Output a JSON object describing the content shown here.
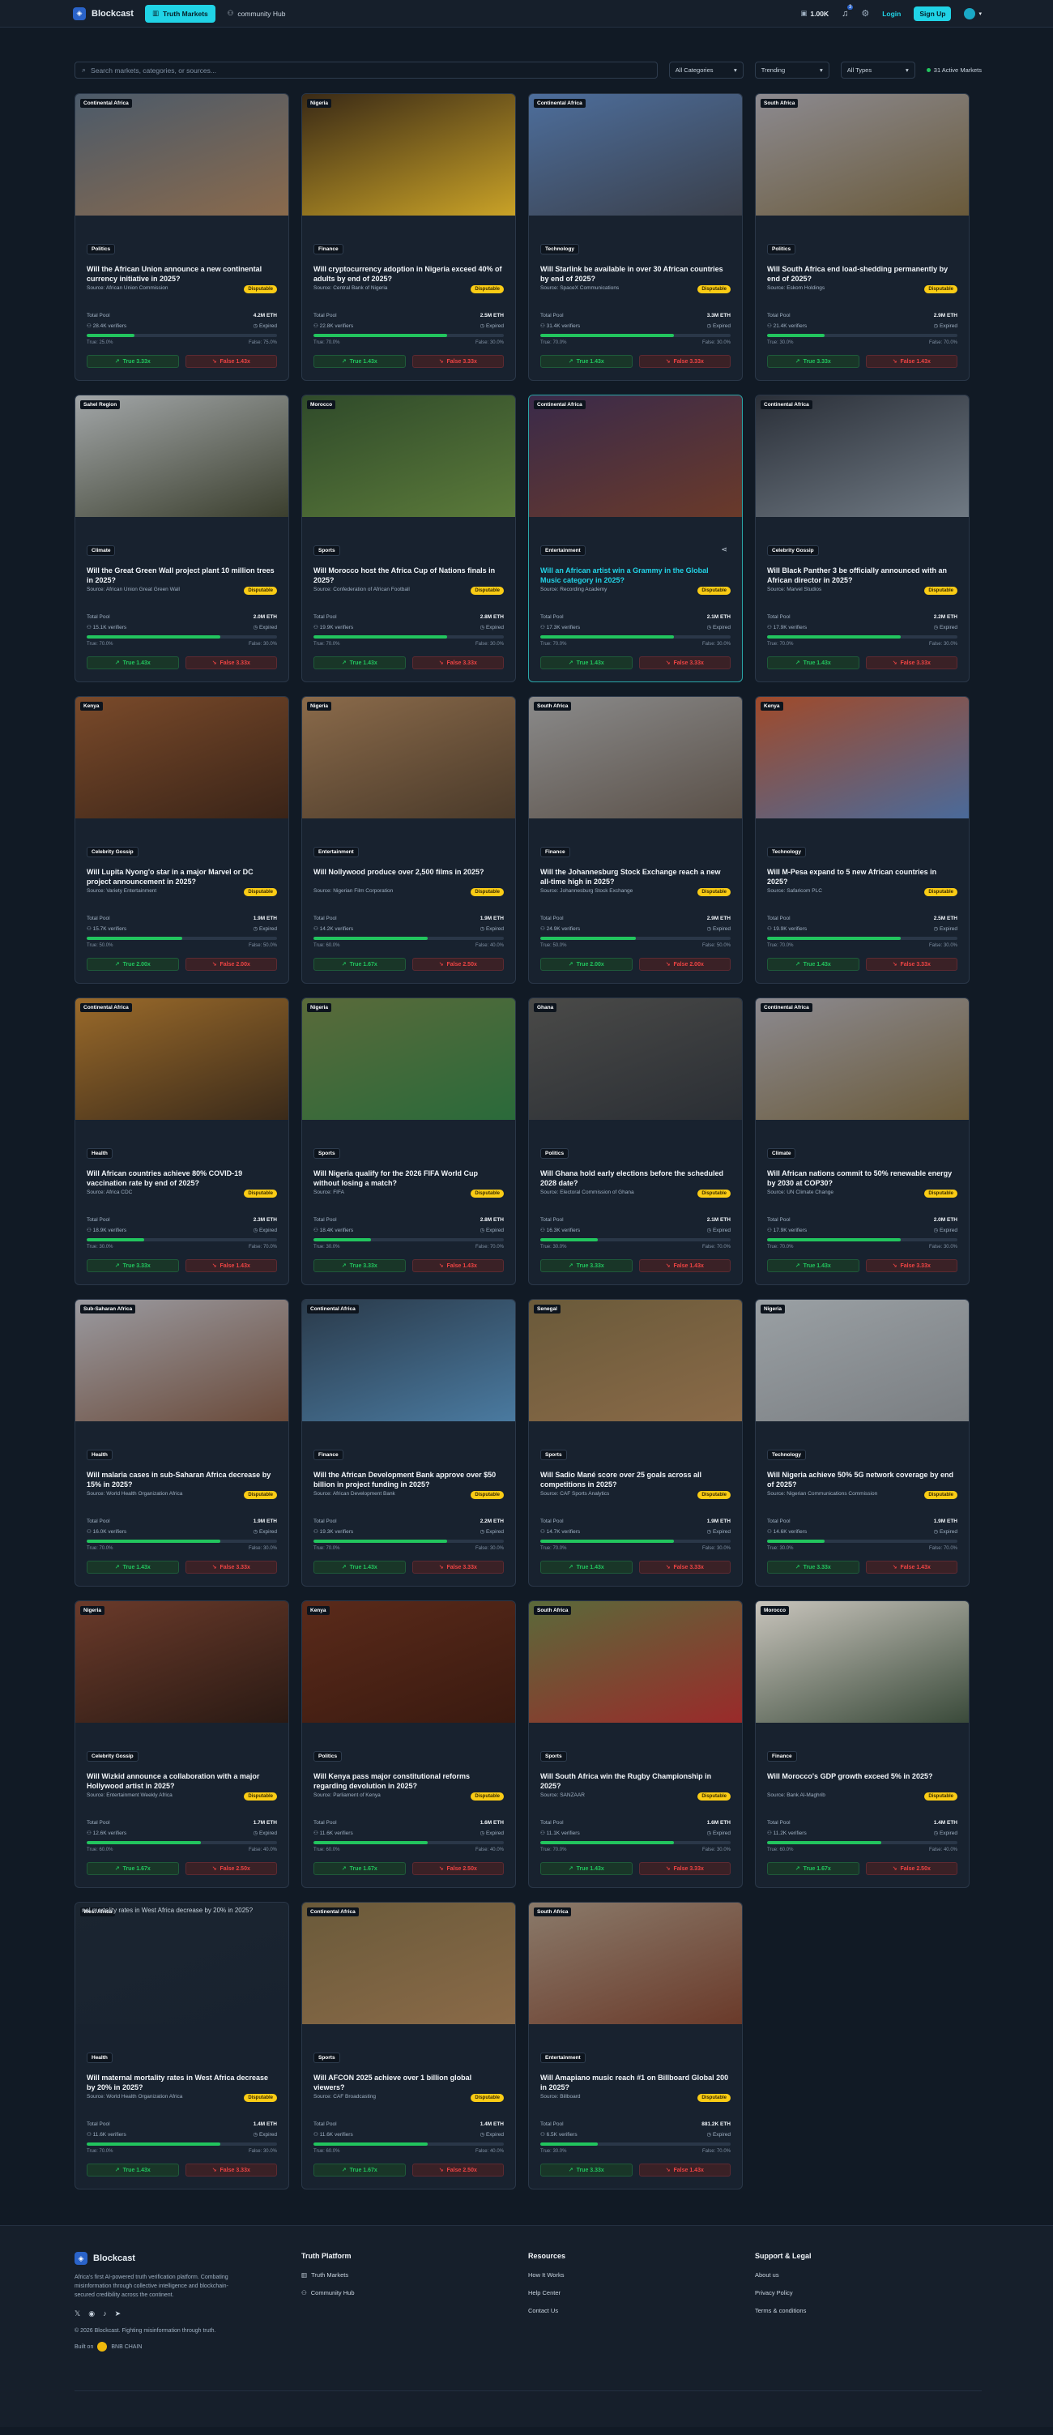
{
  "nav": {
    "brand": "Blockcast",
    "tabs": [
      {
        "label": "Truth Markets",
        "icon": "chart-icon"
      },
      {
        "label": "community Hub",
        "icon": "users-icon"
      }
    ],
    "balance": "1.00K",
    "notifications": "3",
    "login": "Login",
    "signup": "Sign Up"
  },
  "filters": {
    "search_placeholder": "Search markets, categories, or sources...",
    "categories": "All Categories",
    "sort": "Trending",
    "types": "All Types",
    "active_count": "31 Active Markets"
  },
  "common": {
    "total_pool_label": "Total Pool",
    "status": "Expired",
    "disputable": "Disputable"
  },
  "markets": [
    {
      "region": "Continental Africa",
      "category": "Politics",
      "question": "Will the African Union announce a new continental currency initiative in 2025?",
      "source": "Source: African Union Commission",
      "pool": "4.2M ETH",
      "verifiers": "28.4K verifiers",
      "true_pct": 25,
      "true_label": "True: 25.0%",
      "false_label": "False: 75.0%",
      "true_odds": "True 3.33x",
      "false_odds": "False 1.43x",
      "img": "#4b5a6a",
      "img2": "#8a6a4c"
    },
    {
      "region": "Nigeria",
      "category": "Finance",
      "question": "Will cryptocurrency adoption in Nigeria exceed 40% of adults by end of 2025?",
      "source": "Source: Central Bank of Nigeria",
      "pool": "2.5M ETH",
      "verifiers": "22.8K verifiers",
      "true_pct": 70,
      "true_label": "True: 70.0%",
      "false_label": "False: 30.0%",
      "true_odds": "True 1.43x",
      "false_odds": "False 3.33x",
      "img": "#3a2a16",
      "img2": "#c9a227"
    },
    {
      "region": "Continental Africa",
      "category": "Technology",
      "question": "Will Starlink be available in over 30 African countries by end of 2025?",
      "source": "Source: SpaceX Communications",
      "pool": "3.3M ETH",
      "verifiers": "31.4K verifiers",
      "true_pct": 70,
      "true_label": "True: 70.0%",
      "false_label": "False: 30.0%",
      "true_odds": "True 1.43x",
      "false_odds": "False 3.33x",
      "img": "#4d6e9c",
      "img2": "#3a3f4a"
    },
    {
      "region": "South Africa",
      "category": "Politics",
      "question": "Will South Africa end load-shedding permanently by end of 2025?",
      "source": "Source: Eskom Holdings",
      "pool": "2.9M ETH",
      "verifiers": "21.4K verifiers",
      "true_pct": 30,
      "true_label": "True: 30.0%",
      "false_label": "False: 70.0%",
      "true_odds": "True 3.33x",
      "false_odds": "False 1.43x",
      "img": "#8c8a90",
      "img2": "#6a5a3a"
    },
    {
      "region": "Sahel Region",
      "category": "Climate",
      "question": "Will the Great Green Wall project plant 10 million trees in 2025?",
      "source": "Source: African Union Great Green Wall",
      "pool": "2.0M ETH",
      "verifiers": "15.1K verifiers",
      "true_pct": 70,
      "true_label": "True: 70.0%",
      "false_label": "False: 30.0%",
      "true_odds": "True 1.43x",
      "false_odds": "False 3.33x",
      "img": "#a2a6a8",
      "img2": "#3b3f2e"
    },
    {
      "region": "Morocco",
      "category": "Sports",
      "question": "Will Morocco host the Africa Cup of Nations finals in 2025?",
      "source": "Source: Confederation of African Football",
      "pool": "2.8M ETH",
      "verifiers": "19.9K verifiers",
      "true_pct": 70,
      "true_label": "True: 70.0%",
      "false_label": "False: 30.0%",
      "true_odds": "True 1.43x",
      "false_odds": "False 3.33x",
      "img": "#2f4a2a",
      "img2": "#5b7a3a"
    },
    {
      "region": "Continental Africa",
      "category": "Entertainment",
      "question": "Will an African artist win a Grammy in the Global Music category in 2025?",
      "source": "Source: Recording Academy",
      "pool": "2.1M ETH",
      "verifiers": "17.3K verifiers",
      "true_pct": 70,
      "true_label": "True: 70.0%",
      "false_label": "False: 30.0%",
      "true_odds": "True 1.43x",
      "false_odds": "False 3.33x",
      "img": "#3a2a4a",
      "img2": "#6a3a2a",
      "highlight": true
    },
    {
      "region": "Continental Africa",
      "category": "Celebrity Gossip",
      "question": "Will Black Panther 3 be officially announced with an African director in 2025?",
      "source": "Source: Marvel Studios",
      "pool": "2.2M ETH",
      "verifiers": "17.9K verifiers",
      "true_pct": 70,
      "true_label": "True: 70.0%",
      "false_label": "False: 30.0%",
      "true_odds": "True 1.43x",
      "false_odds": "False 3.33x",
      "img": "#2a2f38",
      "img2": "#707a84"
    },
    {
      "region": "Kenya",
      "category": "Celebrity Gossip",
      "question": "Will Lupita Nyong'o star in a major Marvel or DC project announcement in 2025?",
      "source": "Source: Variety Entertainment",
      "pool": "1.9M ETH",
      "verifiers": "15.7K verifiers",
      "true_pct": 50,
      "true_label": "True: 50.0%",
      "false_label": "False: 50.0%",
      "true_odds": "True 2.00x",
      "false_odds": "False 2.00x",
      "img": "#7a4a2a",
      "img2": "#3a2418"
    },
    {
      "region": "Nigeria",
      "category": "Entertainment",
      "question": "Will Nollywood produce over 2,500 films in 2025?",
      "source": "Source: Nigerian Film Corporation",
      "pool": "1.9M ETH",
      "verifiers": "14.2K verifiers",
      "true_pct": 60,
      "true_label": "True: 60.0%",
      "false_label": "False: 40.0%",
      "true_odds": "True 1.67x",
      "false_odds": "False 2.50x",
      "img": "#8a6a4a",
      "img2": "#4a3a2a"
    },
    {
      "region": "South Africa",
      "category": "Finance",
      "question": "Will the Johannesburg Stock Exchange reach a new all-time high in 2025?",
      "source": "Source: Johannesburg Stock Exchange",
      "pool": "2.9M ETH",
      "verifiers": "24.9K verifiers",
      "true_pct": 50,
      "true_label": "True: 50.0%",
      "false_label": "False: 50.0%",
      "true_odds": "True 2.00x",
      "false_odds": "False 2.00x",
      "img": "#8a8a8a",
      "img2": "#5a5048"
    },
    {
      "region": "Kenya",
      "category": "Technology",
      "question": "Will M-Pesa expand to 5 new African countries in 2025?",
      "source": "Source: Safaricom PLC",
      "pool": "2.5M ETH",
      "verifiers": "19.9K verifiers",
      "true_pct": 70,
      "true_label": "True: 70.0%",
      "false_label": "False: 30.0%",
      "true_odds": "True 1.43x",
      "false_odds": "False 3.33x",
      "img": "#a04a2a",
      "img2": "#4a6a9a"
    },
    {
      "region": "Continental Africa",
      "category": "Health",
      "question": "Will African countries achieve 80% COVID-19 vaccination rate by end of 2025?",
      "source": "Source: Africa CDC",
      "pool": "2.3M ETH",
      "verifiers": "18.9K verifiers",
      "true_pct": 30,
      "true_label": "True: 30.0%",
      "false_label": "False: 70.0%",
      "true_odds": "True 3.33x",
      "false_odds": "False 1.43x",
      "img": "#9a6a2a",
      "img2": "#3a2a1a"
    },
    {
      "region": "Nigeria",
      "category": "Sports",
      "question": "Will Nigeria qualify for the 2026 FIFA World Cup without losing a match?",
      "source": "Source: FIFA",
      "pool": "2.8M ETH",
      "verifiers": "18.4K verifiers",
      "true_pct": 30,
      "true_label": "True: 30.0%",
      "false_label": "False: 70.0%",
      "true_odds": "True 3.33x",
      "false_odds": "False 1.43x",
      "img": "#5a6a3a",
      "img2": "#2a6a3a"
    },
    {
      "region": "Ghana",
      "category": "Politics",
      "question": "Will Ghana hold early elections before the scheduled 2028 date?",
      "source": "Source: Electoral Commission of Ghana",
      "pool": "2.1M ETH",
      "verifiers": "16.3K verifiers",
      "true_pct": 30,
      "true_label": "True: 30.0%",
      "false_label": "False: 70.0%",
      "true_odds": "True 3.33x",
      "false_odds": "False 1.43x",
      "img": "#4a4a48",
      "img2": "#2a2e34"
    },
    {
      "region": "Continental Africa",
      "category": "Climate",
      "question": "Will African nations commit to 50% renewable energy by 2030 at COP30?",
      "source": "Source: UN Climate Change",
      "pool": "2.0M ETH",
      "verifiers": "17.9K verifiers",
      "true_pct": 70,
      "true_label": "True: 70.0%",
      "false_label": "False: 30.0%",
      "true_odds": "True 1.43x",
      "false_odds": "False 3.33x",
      "img": "#8c8a90",
      "img2": "#6a5a3a"
    },
    {
      "region": "Sub-Saharan Africa",
      "category": "Health",
      "question": "Will malaria cases in sub-Saharan Africa decrease by 15% in 2025?",
      "source": "Source: World Health Organization Africa",
      "pool": "1.9M ETH",
      "verifiers": "16.0K verifiers",
      "true_pct": 70,
      "true_label": "True: 70.0%",
      "false_label": "False: 30.0%",
      "true_odds": "True 1.43x",
      "false_odds": "False 3.33x",
      "img": "#9a9aa0",
      "img2": "#6a4a3a"
    },
    {
      "region": "Continental Africa",
      "category": "Finance",
      "question": "Will the African Development Bank approve over $50 billion in project funding in 2025?",
      "source": "Source: African Development Bank",
      "pool": "2.2M ETH",
      "verifiers": "19.3K verifiers",
      "true_pct": 70,
      "true_label": "True: 70.0%",
      "false_label": "False: 30.0%",
      "true_odds": "True 1.43x",
      "false_odds": "False 3.33x",
      "img": "#2a3a4a",
      "img2": "#4a7aa0"
    },
    {
      "region": "Senegal",
      "category": "Sports",
      "question": "Will Sadio Mané score over 25 goals across all competitions in 2025?",
      "source": "Source: CAF Sports Analytics",
      "pool": "1.9M ETH",
      "verifiers": "14.7K verifiers",
      "true_pct": 70,
      "true_label": "True: 70.0%",
      "false_label": "False: 30.0%",
      "true_odds": "True 1.43x",
      "false_odds": "False 3.33x",
      "img": "#6a5a3a",
      "img2": "#8a6a48"
    },
    {
      "region": "Nigeria",
      "category": "Technology",
      "question": "Will Nigeria achieve 50% 5G network coverage by end of 2025?",
      "source": "Source: Nigerian Communications Commission",
      "pool": "1.9M ETH",
      "verifiers": "14.6K verifiers",
      "true_pct": 30,
      "true_label": "True: 30.0%",
      "false_label": "False: 70.0%",
      "true_odds": "True 3.33x",
      "false_odds": "False 1.43x",
      "img": "#9aa0a4",
      "img2": "#7a7e82"
    },
    {
      "region": "Nigeria",
      "category": "Celebrity Gossip",
      "question": "Will Wizkid announce a collaboration with a major Hollywood artist in 2025?",
      "source": "Source: Entertainment Weekly Africa",
      "pool": "1.7M ETH",
      "verifiers": "12.6K verifiers",
      "true_pct": 60,
      "true_label": "True: 60.0%",
      "false_label": "False: 40.0%",
      "true_odds": "True 1.67x",
      "false_odds": "False 2.50x",
      "img": "#6a3a2a",
      "img2": "#2a1a14"
    },
    {
      "region": "Kenya",
      "category": "Politics",
      "question": "Will Kenya pass major constitutional reforms regarding devolution in 2025?",
      "source": "Source: Parliament of Kenya",
      "pool": "1.6M ETH",
      "verifiers": "11.6K verifiers",
      "true_pct": 60,
      "true_label": "True: 60.0%",
      "false_label": "False: 40.0%",
      "true_odds": "True 1.67x",
      "false_odds": "False 2.50x",
      "img": "#5a2a1a",
      "img2": "#3a1a10"
    },
    {
      "region": "South Africa",
      "category": "Sports",
      "question": "Will South Africa win the Rugby Championship in 2025?",
      "source": "Source: SANZAAR",
      "pool": "1.6M ETH",
      "verifiers": "11.1K verifiers",
      "true_pct": 70,
      "true_label": "True: 70.0%",
      "false_label": "False: 30.0%",
      "true_odds": "True 1.43x",
      "false_odds": "False 3.33x",
      "img": "#5a6a3a",
      "img2": "#9a2a2a"
    },
    {
      "region": "Morocco",
      "category": "Finance",
      "question": "Will Morocco's GDP growth exceed 5% in 2025?",
      "source": "Source: Bank Al-Maghrib",
      "pool": "1.4M ETH",
      "verifiers": "11.2K verifiers",
      "true_pct": 60,
      "true_label": "True: 60.0%",
      "false_label": "False: 40.0%",
      "true_odds": "True 1.67x",
      "false_odds": "False 2.50x",
      "img": "#c8c4bc",
      "img2": "#3a4a3a"
    },
    {
      "region": "West Africa",
      "category": "Health",
      "question": "Will maternal mortality rates in West Africa decrease by 20% in 2025?",
      "source": "Source: World Health Organization Africa",
      "pool": "1.4M ETH",
      "verifiers": "11.6K verifiers",
      "true_pct": 70,
      "true_label": "True: 70.0%",
      "false_label": "False: 30.0%",
      "true_odds": "True 1.43x",
      "false_odds": "False 3.33x",
      "img": "#1b2530",
      "img2": "#18222f",
      "broken_img_text": "nal mortality rates in West Africa decrease by 20% in 2025?"
    },
    {
      "region": "Continental Africa",
      "category": "Sports",
      "question": "Will AFCON 2025 achieve over 1 billion global viewers?",
      "source": "Source: CAF Broadcasting",
      "pool": "1.4M ETH",
      "verifiers": "11.6K verifiers",
      "true_pct": 60,
      "true_label": "True: 60.0%",
      "false_label": "False: 40.0%",
      "true_odds": "True 1.67x",
      "false_odds": "False 2.50x",
      "img": "#6a5a3a",
      "img2": "#8a6a48"
    },
    {
      "region": "South Africa",
      "category": "Entertainment",
      "question": "Will Amapiano music reach #1 on Billboard Global 200 in 2025?",
      "source": "Source: Billboard",
      "pool": "881.2K ETH",
      "verifiers": "6.5K verifiers",
      "true_pct": 30,
      "true_label": "True: 30.0%",
      "false_label": "False: 70.0%",
      "true_odds": "True 3.33x",
      "false_odds": "False 1.43x",
      "img": "#8a7a6a",
      "img2": "#6a3a2a"
    }
  ],
  "footer": {
    "brand": "Blockcast",
    "description": "Africa's first AI-powered truth verification platform. Combating misinformation through collective intelligence and blockchain-secured credibility across the continent.",
    "copyright": "© 2026 Blockcast. Fighting misinformation through truth.",
    "built_on": "Built on",
    "chain": "BNB CHAIN",
    "platform": {
      "title": "Truth Platform",
      "links": [
        "Truth Markets",
        "Community Hub"
      ]
    },
    "resources": {
      "title": "Resources",
      "links": [
        "How It Works",
        "Help Center",
        "Contact Us"
      ]
    },
    "legal": {
      "title": "Support & Legal",
      "links": [
        "About us",
        "Privacy Policy",
        "Terms & conditions"
      ]
    }
  }
}
